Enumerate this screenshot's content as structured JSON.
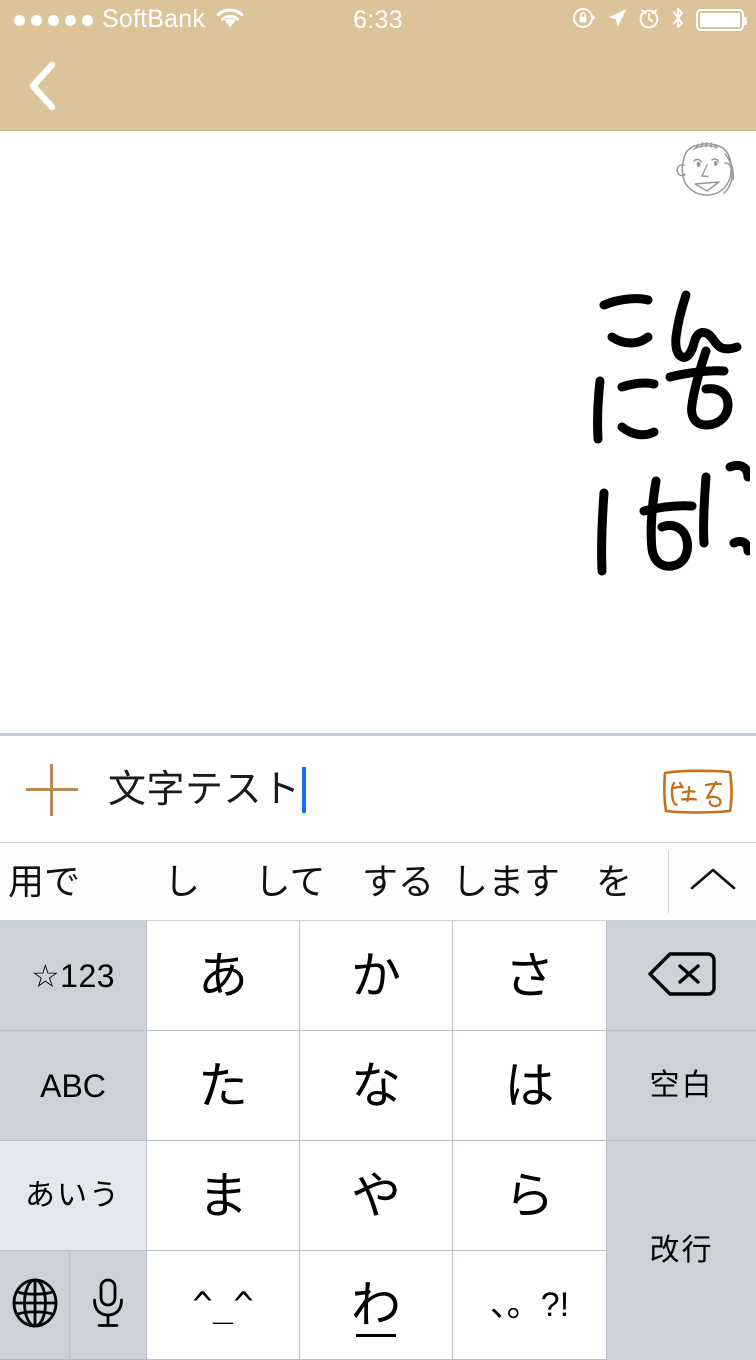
{
  "status_bar": {
    "signal_dots": 5,
    "carrier": "SoftBank",
    "wifi_icon": "wifi-icon",
    "time": "6:33",
    "icons": [
      "rotation-lock-icon",
      "location-arrow-icon",
      "alarm-clock-icon",
      "bluetooth-icon",
      "battery-icon"
    ],
    "background_color": "#dcc49a",
    "foreground_color": "#ffffff"
  },
  "nav_bar": {
    "back_icon": "back-chevron-icon",
    "background_color": "#dcc49a"
  },
  "message_canvas": {
    "avatar_icon": "hand-drawn-face-avatar",
    "handwritten_message": "こんにちは",
    "handwriting_color": "#000000",
    "background_color": "#ffffff",
    "divider_color": "#c3cdeb"
  },
  "input_bar": {
    "add_icon": "plus-icon",
    "add_icon_color": "#bb8855",
    "text_value": "文字テスト",
    "placeholder": "",
    "caret_color": "#1a6ef5",
    "send_label": "送る",
    "send_color": "#c4701f"
  },
  "suggestion_bar": {
    "items": [
      "用で",
      "し",
      "して",
      "する",
      "します",
      "を"
    ],
    "expand_icon": "chevron-up-icon",
    "expand_label": "∧"
  },
  "keyboard": {
    "type": "japanese-kana-12key",
    "rows": [
      {
        "keys": [
          {
            "name": "key-symbols-123",
            "label": "☆123",
            "style": "gray"
          },
          {
            "name": "key-a",
            "label": "あ",
            "style": "white"
          },
          {
            "name": "key-ka",
            "label": "か",
            "style": "white"
          },
          {
            "name": "key-sa",
            "label": "さ",
            "style": "white"
          },
          {
            "name": "key-delete",
            "label": "⌫",
            "style": "gray"
          }
        ]
      },
      {
        "keys": [
          {
            "name": "key-abc",
            "label": "ABC",
            "style": "gray"
          },
          {
            "name": "key-ta",
            "label": "た",
            "style": "white"
          },
          {
            "name": "key-na",
            "label": "な",
            "style": "white"
          },
          {
            "name": "key-ha",
            "label": "は",
            "style": "white"
          },
          {
            "name": "key-space",
            "label": "空白",
            "style": "gray"
          }
        ]
      },
      {
        "keys": [
          {
            "name": "key-aiu",
            "label": "あいう",
            "style": "light"
          },
          {
            "name": "key-ma",
            "label": "ま",
            "style": "white"
          },
          {
            "name": "key-ya",
            "label": "や",
            "style": "white"
          },
          {
            "name": "key-ra",
            "label": "ら",
            "style": "white"
          },
          {
            "name": "key-return",
            "label": "改行",
            "style": "gray"
          }
        ]
      },
      {
        "keys": [
          {
            "name": "key-globe",
            "label": "",
            "style": "gray",
            "icon": "globe-icon"
          },
          {
            "name": "key-microphone",
            "label": "",
            "style": "gray",
            "icon": "microphone-icon"
          },
          {
            "name": "key-emoticon",
            "label": "^_^",
            "style": "white"
          },
          {
            "name": "key-wa",
            "label": "わ",
            "style": "white"
          },
          {
            "name": "key-punctuation",
            "label": "、。?!",
            "style": "white"
          }
        ]
      }
    ],
    "colors": {
      "gray_key": "#cdd2da",
      "light_key": "#e3e8ee",
      "white_key": "#ffffff",
      "border": "#b9bfcb"
    }
  }
}
